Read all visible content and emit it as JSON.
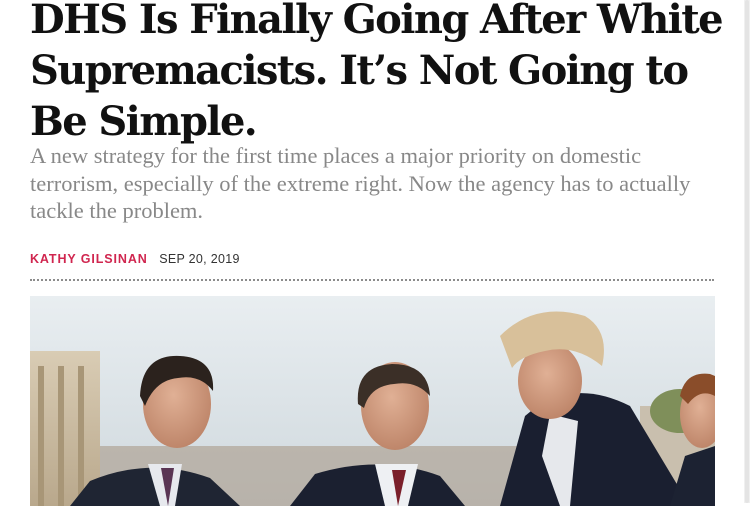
{
  "article": {
    "headline": "DHS Is Finally Going After White Supremacists. It’s Not Going to Be Simple.",
    "dek": "A new strategy for the first time places a major priority on domestic terrorism, especially of the extreme right. Now the agency has to actually tackle the problem.",
    "author": "KATHY GILSINAN",
    "date": "SEP 20, 2019"
  },
  "photo": {
    "icon": "news-photo",
    "colors": {
      "sky": "#d6dde1",
      "building": "#cdbfa6",
      "suit": "#1d2433",
      "skin": "#c99478",
      "hair": "#d9c3a0"
    }
  },
  "colors": {
    "accent": "#d0264f",
    "headline": "#111111",
    "dek": "#888888"
  }
}
